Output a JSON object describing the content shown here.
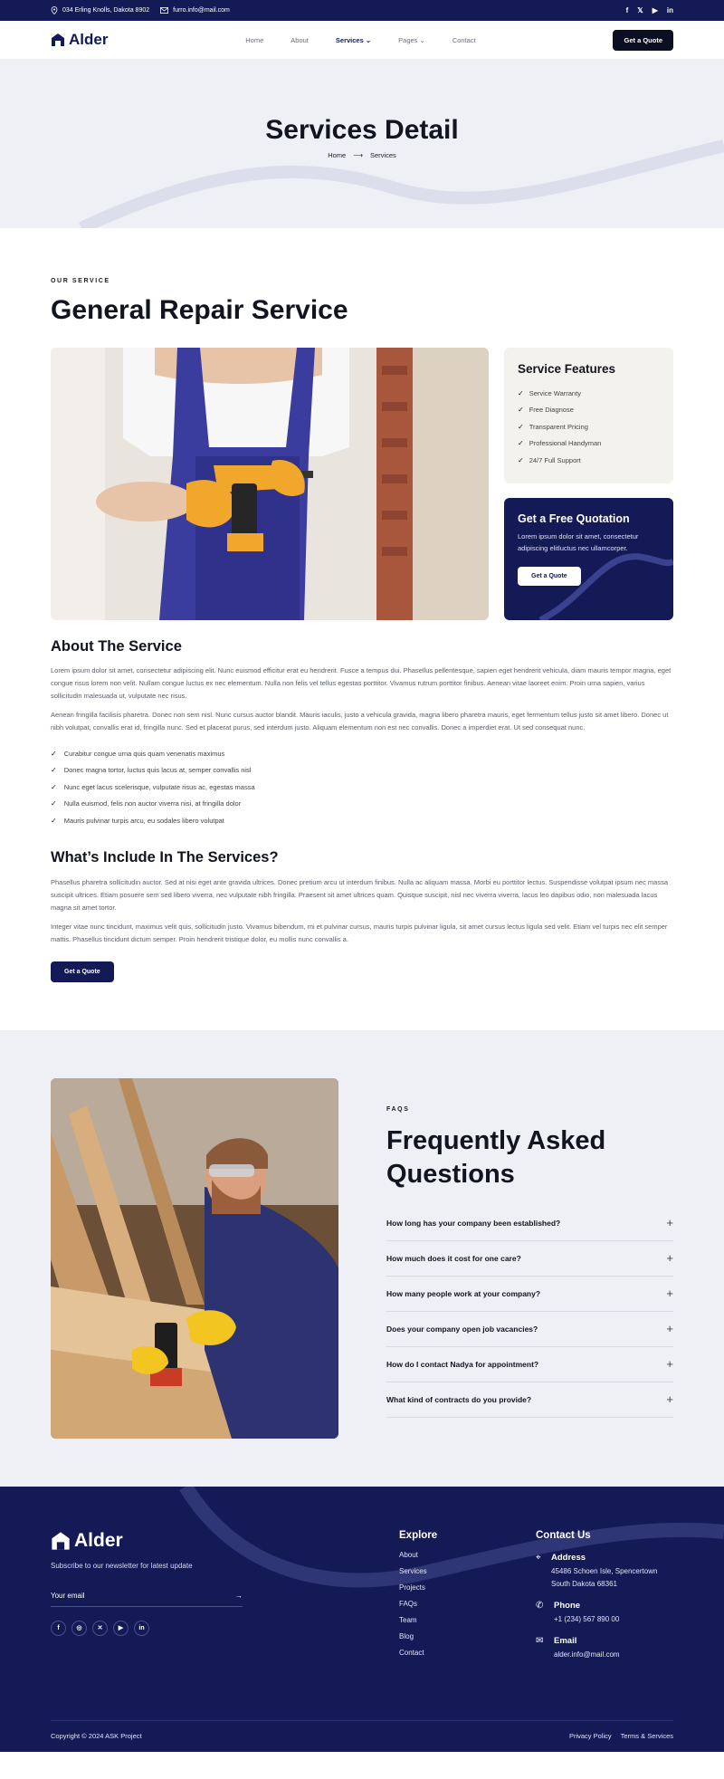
{
  "topbar": {
    "address": "034 Erling Knolls, Dakota 8902",
    "email": "furro.info@mail.com",
    "social_icons": [
      "facebook-icon",
      "twitter-icon",
      "youtube-icon",
      "linkedin-icon"
    ],
    "social_glyphs": [
      "f",
      "𝕏",
      "▶",
      "in"
    ]
  },
  "header": {
    "logo_text": "Alder",
    "nav": [
      "Home",
      "About",
      "Services",
      "Pages",
      "Contact"
    ],
    "active_nav": "Services",
    "cta": "Get a Quote"
  },
  "hero": {
    "title": "Services Detail",
    "breadcrumb": [
      "Home",
      "Services"
    ]
  },
  "service": {
    "eyebrow": "OUR SERVICE",
    "title": "General Repair Service",
    "features_title": "Service Features",
    "features": [
      "Service Warranty",
      "Free Diagnose",
      "Transparent Pricing",
      "Professional Handyman",
      "24/7 Full Support"
    ],
    "quote_title": "Get a Free Quotation",
    "quote_text": "Lorem ipsum dolor sit amet, consectetur adipiscing elitluctus nec ullamcorper.",
    "quote_button": "Get a Quote"
  },
  "about": {
    "title": "About The Service",
    "paragraphs": [
      "Lorem ipsum dolor sit amet, consectetur adipiscing elit. Nunc euismod efficitur erat eu hendrerit. Fusce a tempus dui. Phasellus pellentesque, sapien eget hendrerit vehicula, diam mauris tempor magna, eget congue risus lorem non velit. Nullam congue luctus ex nec elementum. Nulla non felis vel tellus egestas porttitor. Vivamus rutrum porttitor finibus. Aenean vitae laoreet enim. Proin urna sapien, varius sollicitudin malesuada ut, vulputate nec risus.",
      "Aenean fringilla facilisis pharetra. Donec non sem nisl. Nunc cursus auctor blandit. Mauris iaculis, justo a vehicula gravida, magna libero pharetra mauris, eget fermentum tellus justo sit amet libero. Donec ut nibh volutpat, convallis erat id, fringilla nunc. Sed et placerat purus, sed interdum justo. Aliquam elementum non est nec convallis. Donec a imperdiet erat. Ut sed consequat nunc."
    ],
    "bullets": [
      "Curabitur congue urna quis quam venenatis maximus",
      "Donec magna tortor, luctus quis lacus at, semper convallis nisl",
      "Nunc eget lacus scelerisque, vulputate risus ac, egestas massa",
      "Nulla euismod, felis non auctor viverra nisi, at fringilla dolor",
      "Mauris pulvinar turpis arcu, eu sodales libero volutpat"
    ]
  },
  "include": {
    "title": "What’s Include In The Services?",
    "paragraphs": [
      "Phasellus pharetra sollicitudin auctor. Sed at nisi eget ante gravida ultrices. Donec pretium arcu ut interdum finibus. Nulla ac aliquam massa. Morbi eu porttitor lectus. Suspendisse volutpat ipsum nec massa suscipit ultrices. Etiam posuere sem sed libero viverra, nec vulputate nibh fringilla. Praesent sit amet ultrices quam. Quisque suscipit, nisl nec viverra viverra, lacus leo dapibus odio, non malesuada lacus magna sit amet tortor.",
      "Integer vitae nunc tincidunt, maximus velit quis, sollicitudin justo. Vivamus bibendum, mi et pulvinar cursus, mauris turpis pulvinar ligula, sit amet cursus lectus ligula sed velit. Etiam vel turpis nec elit semper mattis. Phasellus tincidunt dictum semper. Proin hendrerit tristique dolor, eu mollis nunc convallis a."
    ],
    "button": "Get a Quote"
  },
  "faq": {
    "eyebrow": "FAQS",
    "title": "Frequently Asked Questions",
    "questions": [
      "How long has your company been established?",
      "How much does it cost for one care?",
      "How many people work at your company?",
      "Does your company open job vacancies?",
      "How do I contact Nadya for appointment?",
      "What kind of contracts do you provide?"
    ]
  },
  "footer": {
    "logo_text": "Alder",
    "subscribe_text": "Subscribe to our newsletter for latest update",
    "email_placeholder": "Your email",
    "social_icons": [
      "facebook-icon",
      "instagram-icon",
      "x-icon",
      "youtube-icon",
      "linkedin-icon"
    ],
    "social_glyphs": [
      "f",
      "◎",
      "✕",
      "▶",
      "in"
    ],
    "explore_title": "Explore",
    "explore_links": [
      "About",
      "Services",
      "Projects",
      "FAQs",
      "Team",
      "Blog",
      "Contact"
    ],
    "contact_title": "Contact Us",
    "address_title": "Address",
    "address_value": "45486 Schoen Isle, Spencertown South Dakota 68361",
    "phone_title": "Phone",
    "phone_value": "+1 (234) 567 890 00",
    "email_title": "Email",
    "email_value": "alder.info@mail.com",
    "copyright": "Copyright © 2024 ASK Project",
    "bottom_links": [
      "Privacy Policy",
      "Terms & Services"
    ]
  },
  "colors": {
    "navy": "#131a55",
    "hero_bg": "#eef0f5",
    "features_bg": "#f4f2ec",
    "dark_button": "#0c0f22"
  }
}
